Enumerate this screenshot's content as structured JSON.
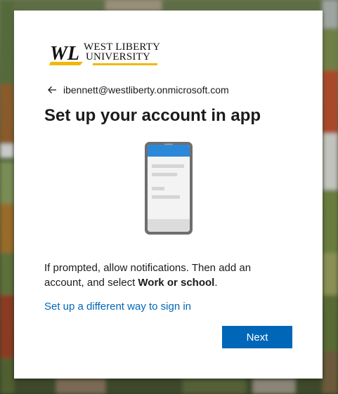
{
  "branding": {
    "logo_monogram": "WL",
    "logo_line1": "WEST LIBERTY",
    "logo_line2": "UNIVERSITY",
    "accent_color": "#f2b705"
  },
  "identity": {
    "back_icon": "arrow-left-icon",
    "email": "ibennett@westliberty.onmicrosoft.com"
  },
  "title": "Set up your account in app",
  "illustration": {
    "icon": "smartphone-icon",
    "screen_header_color": "#2b88d8"
  },
  "description": {
    "text_before": "If prompted, allow notifications. Then add an account, and select ",
    "emphasis": "Work or school",
    "text_after": "."
  },
  "alternate_link": "Set up a different way to sign in",
  "next_button": "Next",
  "colors": {
    "primary": "#0067b8",
    "link": "#0067b8",
    "text": "#1b1b1b"
  }
}
